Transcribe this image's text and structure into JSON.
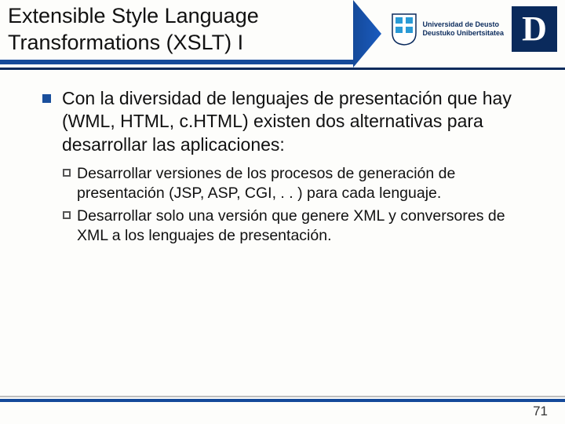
{
  "header": {
    "title": "Extensible Style Language Transformations (XSLT) I",
    "university_line1": "Universidad de Deusto",
    "university_line2": "Deustuko Unibertsitatea",
    "logo_letter": "D"
  },
  "content": {
    "main_bullet": "Con la diversidad de lenguajes de presentación que hay (WML, HTML, c.HTML) existen dos alternativas para desarrollar las aplicaciones:",
    "sub_bullets": [
      "Desarrollar versiones de los procesos de generación de presentación (JSP, ASP, CGI, . . ) para cada lenguaje.",
      "Desarrollar solo una versión que genere XML y conversores de XML a los lenguajes de presentación."
    ]
  },
  "footer": {
    "page_number": "71"
  }
}
